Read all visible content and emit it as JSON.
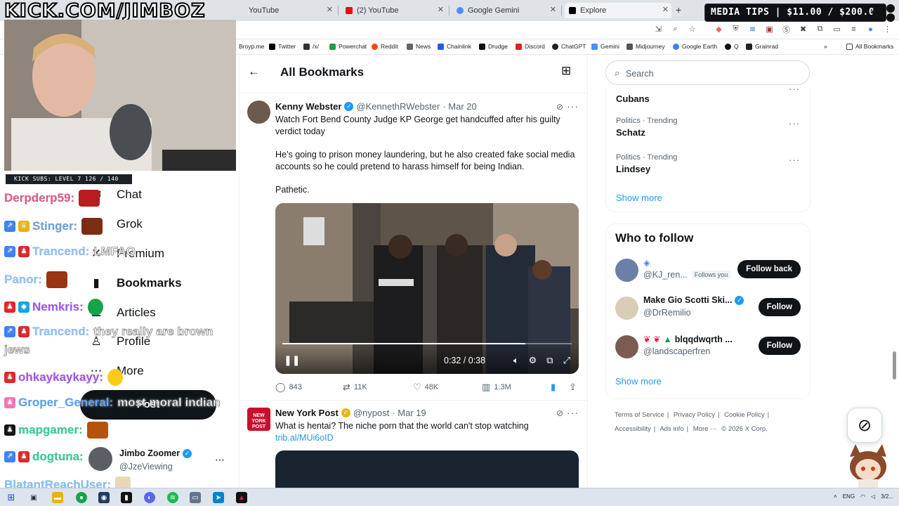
{
  "browser": {
    "tabs": [
      {
        "label": "YouTube"
      },
      {
        "label": "(2) YouTube"
      },
      {
        "label": "Google Gemini"
      },
      {
        "label": "Explore"
      }
    ],
    "new_tab": "+",
    "bookmarks": [
      "Broyp.me",
      "Twitter",
      "/x/",
      "Powerchat",
      "Reddit",
      "News",
      "Chainlink",
      "Drudge",
      "Discord",
      "ChatGPT",
      "Gemini",
      "Midjourney",
      "Google Earth",
      "Q",
      "Grainrad"
    ],
    "all_bookmarks": "All Bookmarks",
    "more_bookmarks": "»"
  },
  "stream": {
    "banner": "KICK.COM/JIMBOZ",
    "media_tips": "MEDIA TIPS | $11.00 / $200.00",
    "subs_bar": "KICK SUBS: LEVEL 7 126 / 140",
    "chat": [
      {
        "user": "Derpderp59:",
        "color": "#e35d8f",
        "msg": ""
      },
      {
        "user": "Stinger:",
        "color": "#6fa8dc",
        "msg": ""
      },
      {
        "user": "Trancend:",
        "color": "#93c5fd",
        "msg": "LMFAO"
      },
      {
        "user": "Panor:",
        "color": "#93c5fd",
        "msg": ""
      },
      {
        "user": "Nemkris:",
        "color": "#a855f7",
        "msg": ""
      },
      {
        "user": "Trancend:",
        "color": "#93c5fd",
        "msg": "they really are brown"
      },
      {
        "user": "",
        "color": "#93c5fd",
        "msg": "jews"
      },
      {
        "user": "ohkaykaykayy:",
        "color": "#a855f7",
        "msg": ""
      },
      {
        "user": "Groper_General:",
        "color": "#60a5fa",
        "msg": "most moral indian"
      },
      {
        "user": "mapgamer:",
        "color": "#34d399",
        "msg": ""
      },
      {
        "user": "dogtuna:",
        "color": "#34d399",
        "msg": ""
      },
      {
        "user": "BlatantReachUser:",
        "color": "#86c5f5",
        "msg": ""
      }
    ]
  },
  "nav": {
    "items": [
      {
        "label": "Chat",
        "icon": "chat-icon"
      },
      {
        "label": "Grok",
        "icon": "grok-icon"
      },
      {
        "label": "Premium",
        "icon": "premium-icon"
      },
      {
        "label": "Bookmarks",
        "icon": "bookmark-icon"
      },
      {
        "label": "Articles",
        "icon": "articles-icon"
      },
      {
        "label": "Profile",
        "icon": "profile-icon"
      },
      {
        "label": "More",
        "icon": "more-icon"
      }
    ],
    "post_label": "Post",
    "me": {
      "name": "Jimbo Zoomer",
      "handle": "@JzeViewing"
    }
  },
  "feed": {
    "title": "All Bookmarks",
    "tweets": [
      {
        "name": "Kenny Webster",
        "handle": "@KennethRWebster",
        "date": "· Mar 20",
        "text1": "Watch Fort Bend County Judge KP George get handcuffed after his guilty verdict today",
        "text2": "He’s going to prison money laundering, but he also created fake social media accounts so he could pretend to harass himself for being Indian.",
        "text3": "Pathetic.",
        "video_time": "0:32 / 0:38",
        "video_progress": 0.84,
        "replies": "843",
        "reposts": "11K",
        "likes": "48K",
        "views": "1.3M"
      },
      {
        "name": "New York Post",
        "handle": "@nypost",
        "date": "· Mar 19",
        "text1": "What is hentai? The niche porn that the world can't stop watching",
        "link": "trib.al/MUi6oID"
      }
    ]
  },
  "sidebar": {
    "search_placeholder": "Search",
    "trends": [
      {
        "meta": "",
        "topic": "Cubans"
      },
      {
        "meta": "Politics · Trending",
        "topic": "Schatz"
      },
      {
        "meta": "Politics · Trending",
        "topic": "Lindsey"
      }
    ],
    "show_more": "Show more",
    "who_to_follow": "Who to follow",
    "follow_suggestions": [
      {
        "name": "",
        "handle": "@KJ_ren...",
        "tag": "Follows you",
        "button": "Follow back"
      },
      {
        "name": "Make Gio Scotti Ski...",
        "handle": "@DrRemilio",
        "tag": "",
        "button": "Follow"
      },
      {
        "name": "blqqdwqrth ...",
        "handle": "@landscaperfren",
        "tag": "",
        "button": "Follow"
      }
    ],
    "show_more_2": "Show more",
    "footer": [
      "Terms of Service",
      "|",
      "Privacy Policy",
      "|",
      "Cookie Policy",
      "|",
      "Accessibility",
      "|",
      "Ads info",
      "|",
      "More ···",
      "© 2026 X Corp."
    ]
  },
  "taskbar": {
    "lang": "ENG",
    "date": "3/2..."
  }
}
